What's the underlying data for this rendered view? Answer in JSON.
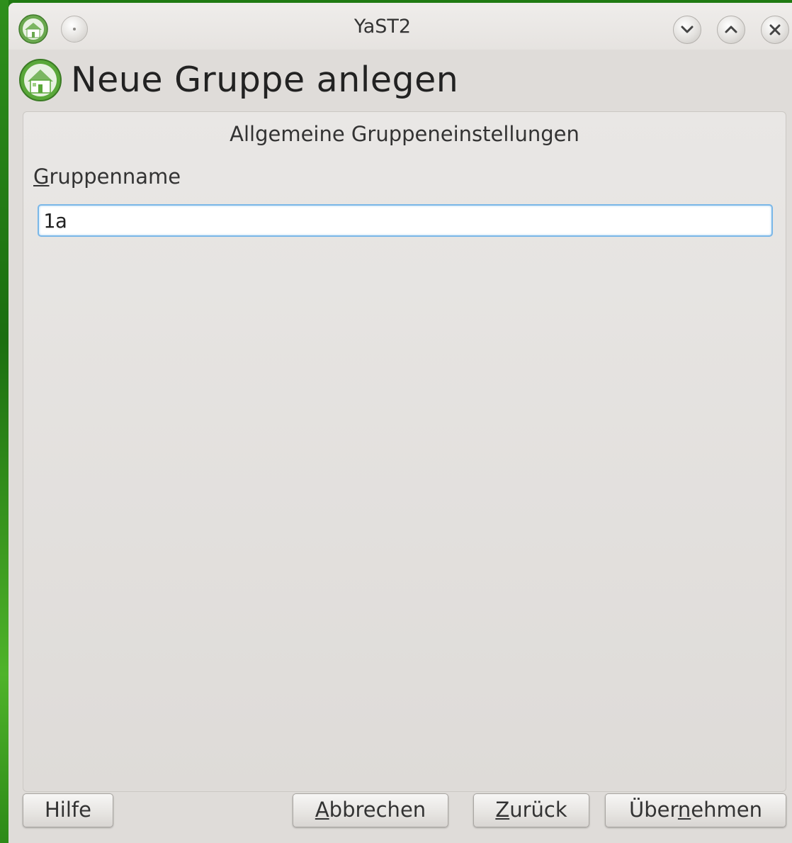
{
  "window": {
    "title": "YaST2"
  },
  "header": {
    "title": "Neue Gruppe anlegen"
  },
  "form": {
    "section_heading": "Allgemeine Gruppeneinstellungen",
    "group_name_label_mnemonic": "G",
    "group_name_label_rest": "ruppenname",
    "group_name_value": "1a"
  },
  "buttons": {
    "help": "Hilfe",
    "cancel_mnemonic": "A",
    "cancel_rest": "bbrechen",
    "back_mnemonic": "Z",
    "back_rest": "urück",
    "apply_pre": "Über",
    "apply_mnemonic": "n",
    "apply_post": "ehmen"
  },
  "icons": {
    "app": "yast-house-icon",
    "pin": "pin-icon",
    "minimize": "chevron-down-icon",
    "maximize": "chevron-up-icon",
    "close": "close-icon"
  },
  "colors": {
    "desktop": "#1f7a12",
    "window_bg": "#dfdcd9",
    "input_focus_border": "#7ab7e8",
    "icon_green": "#5aa83a"
  }
}
